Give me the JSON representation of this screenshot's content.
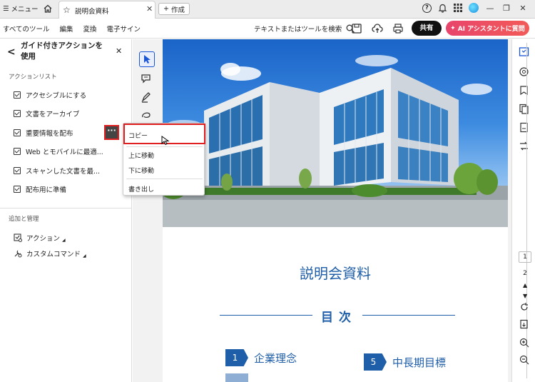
{
  "titlebar": {
    "menu_label": "メニュー",
    "tab_title": "説明会資料",
    "new_tab_label": "作成"
  },
  "toolbar": {
    "menu_items": [
      "すべてのツール",
      "編集",
      "変換",
      "電子サイン"
    ],
    "search_tools_label": "テキストまたはツールを検索",
    "share_label": "共有",
    "ai_label": "AI アシスタントに質問"
  },
  "panel": {
    "title": "ガイド付きアクションを使用",
    "action_list_label": "アクションリスト",
    "actions": [
      "アクセシブルにする",
      "文書をアーカイブ",
      "重要情報を配布",
      "Web とモバイルに最適...",
      "スキャンした文書を最...",
      "配布用に準備"
    ],
    "more_label": "···",
    "manage_label": "追加と管理",
    "manage_items": [
      "アクション",
      "カスタムコマンド"
    ]
  },
  "context_menu": {
    "items": [
      "コピー",
      "上に移動",
      "下に移動",
      "書き出し"
    ]
  },
  "document": {
    "title": "説明会資料",
    "toc_title": "目次",
    "toc_items": [
      {
        "num": "1",
        "label": "企業理念"
      },
      {
        "num": "5",
        "label": "中長期目標"
      }
    ]
  },
  "pages": {
    "current": "1",
    "total": "2"
  },
  "colors": {
    "accent": "#1a55d6",
    "highlight": "#e02020",
    "doc_blue": "#1f5ea8",
    "ai_gradient": "#e8456b"
  }
}
